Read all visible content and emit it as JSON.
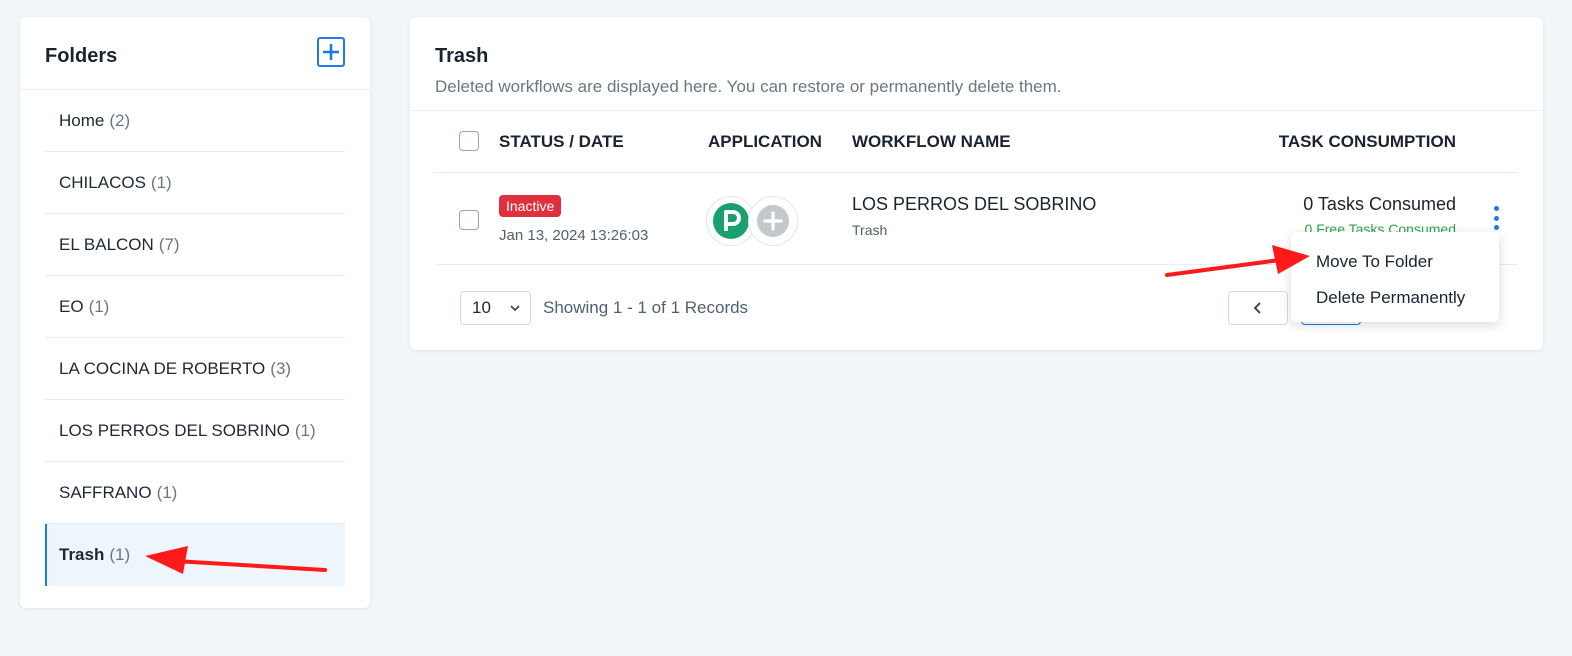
{
  "sidebar": {
    "title": "Folders",
    "add_icon": "plus-icon",
    "folders": [
      {
        "name": "Home",
        "count": "(2)"
      },
      {
        "name": "CHILACOS",
        "count": "(1)"
      },
      {
        "name": "EL BALCON",
        "count": "(7)"
      },
      {
        "name": "EO",
        "count": "(1)"
      },
      {
        "name": "LA COCINA DE ROBERTO",
        "count": "(3)"
      },
      {
        "name": "LOS PERROS DEL SOBRINO",
        "count": "(1)"
      },
      {
        "name": "SAFFRANO",
        "count": "(1)"
      },
      {
        "name": "Trash",
        "count": "(1)"
      }
    ],
    "active_folder": "Trash"
  },
  "main": {
    "title": "Trash",
    "subtitle": "Deleted workflows are displayed here. You can restore or permanently delete them.",
    "columns": [
      "STATUS / DATE",
      "APPLICATION",
      "WORKFLOW NAME",
      "TASK CONSUMPTION"
    ],
    "rows": [
      {
        "status": "Inactive",
        "date": "Jan 13, 2024 13:26:03",
        "apps": [
          "p-app-icon",
          "plus-circle-icon"
        ],
        "workflow_name": "LOS PERROS DEL SOBRINO",
        "folder": "Trash",
        "tasks_consumed": "0 Tasks Consumed",
        "free_tasks_consumed": "0 Free Tasks Consumed"
      }
    ],
    "footer": {
      "page_size": "10",
      "showing": "Showing 1 - 1 of 1 Records"
    }
  },
  "dropdown": {
    "items": [
      "Move To Folder",
      "Delete Permanently"
    ]
  },
  "colors": {
    "accent": "#1a7ae8",
    "status_inactive": "#e0303d",
    "free_tasks": "#2ea84a",
    "annotation_arrow": "#ff1a1a",
    "app_p": "#1aa06e"
  }
}
